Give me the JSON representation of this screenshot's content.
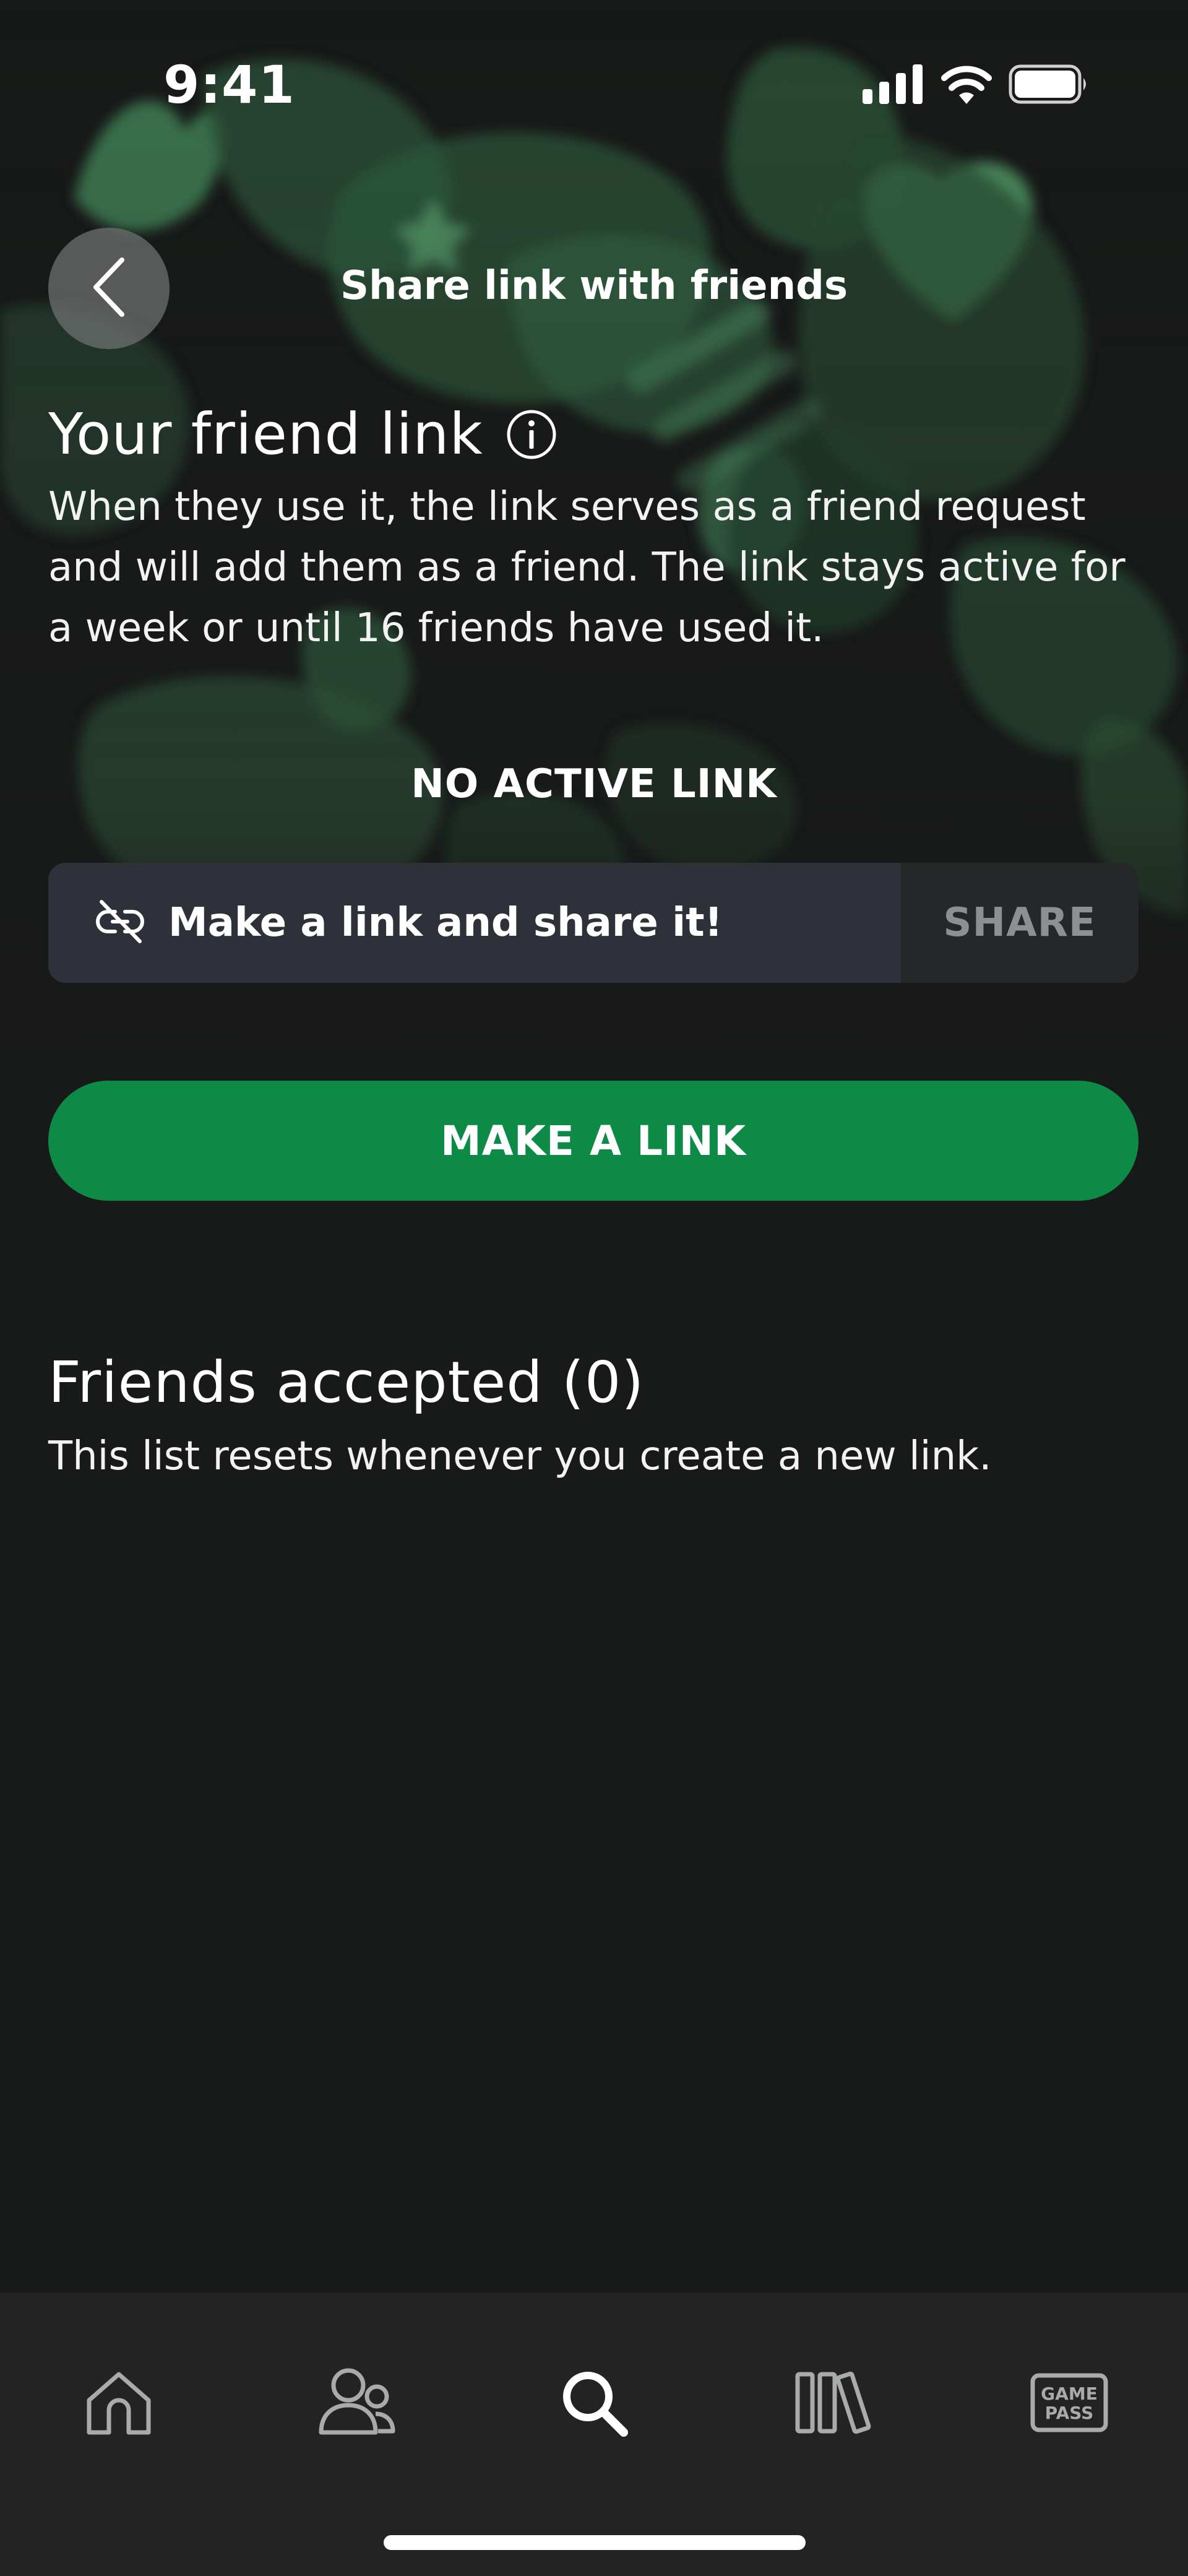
{
  "status_bar": {
    "time": "9:41",
    "icons": [
      "signal-icon",
      "wifi-icon",
      "battery-icon"
    ]
  },
  "header": {
    "title": "Share link with friends",
    "back_icon": "chevron-left-icon"
  },
  "friend_link": {
    "title": "Your friend link",
    "info_icon": "info-icon",
    "description": "When they use it, the link serves as a friend request and will add them as a friend. The link stays active for a week or until 16 friends have used it.",
    "status": "NO ACTIVE LINK",
    "field_text": "Make a link and share it!",
    "field_icon": "broken-link-icon",
    "share_label": "SHARE",
    "make_link_label": "MAKE A LINK"
  },
  "friends_accepted": {
    "title": "Friends accepted (0)",
    "note": "This list resets whenever you create a new link."
  },
  "bottom_nav": {
    "items": [
      {
        "icon": "home-icon",
        "active": false
      },
      {
        "icon": "friends-icon",
        "active": false
      },
      {
        "icon": "search-icon",
        "active": true
      },
      {
        "icon": "library-icon",
        "active": false
      },
      {
        "icon": "game-pass-icon",
        "label_line1": "GAME",
        "label_line2": "PASS",
        "active": false
      }
    ]
  },
  "colors": {
    "background": "#181a19",
    "accent_green": "#0e8a47",
    "nav_background": "#232323",
    "inactive_icon": "#a9abab"
  }
}
